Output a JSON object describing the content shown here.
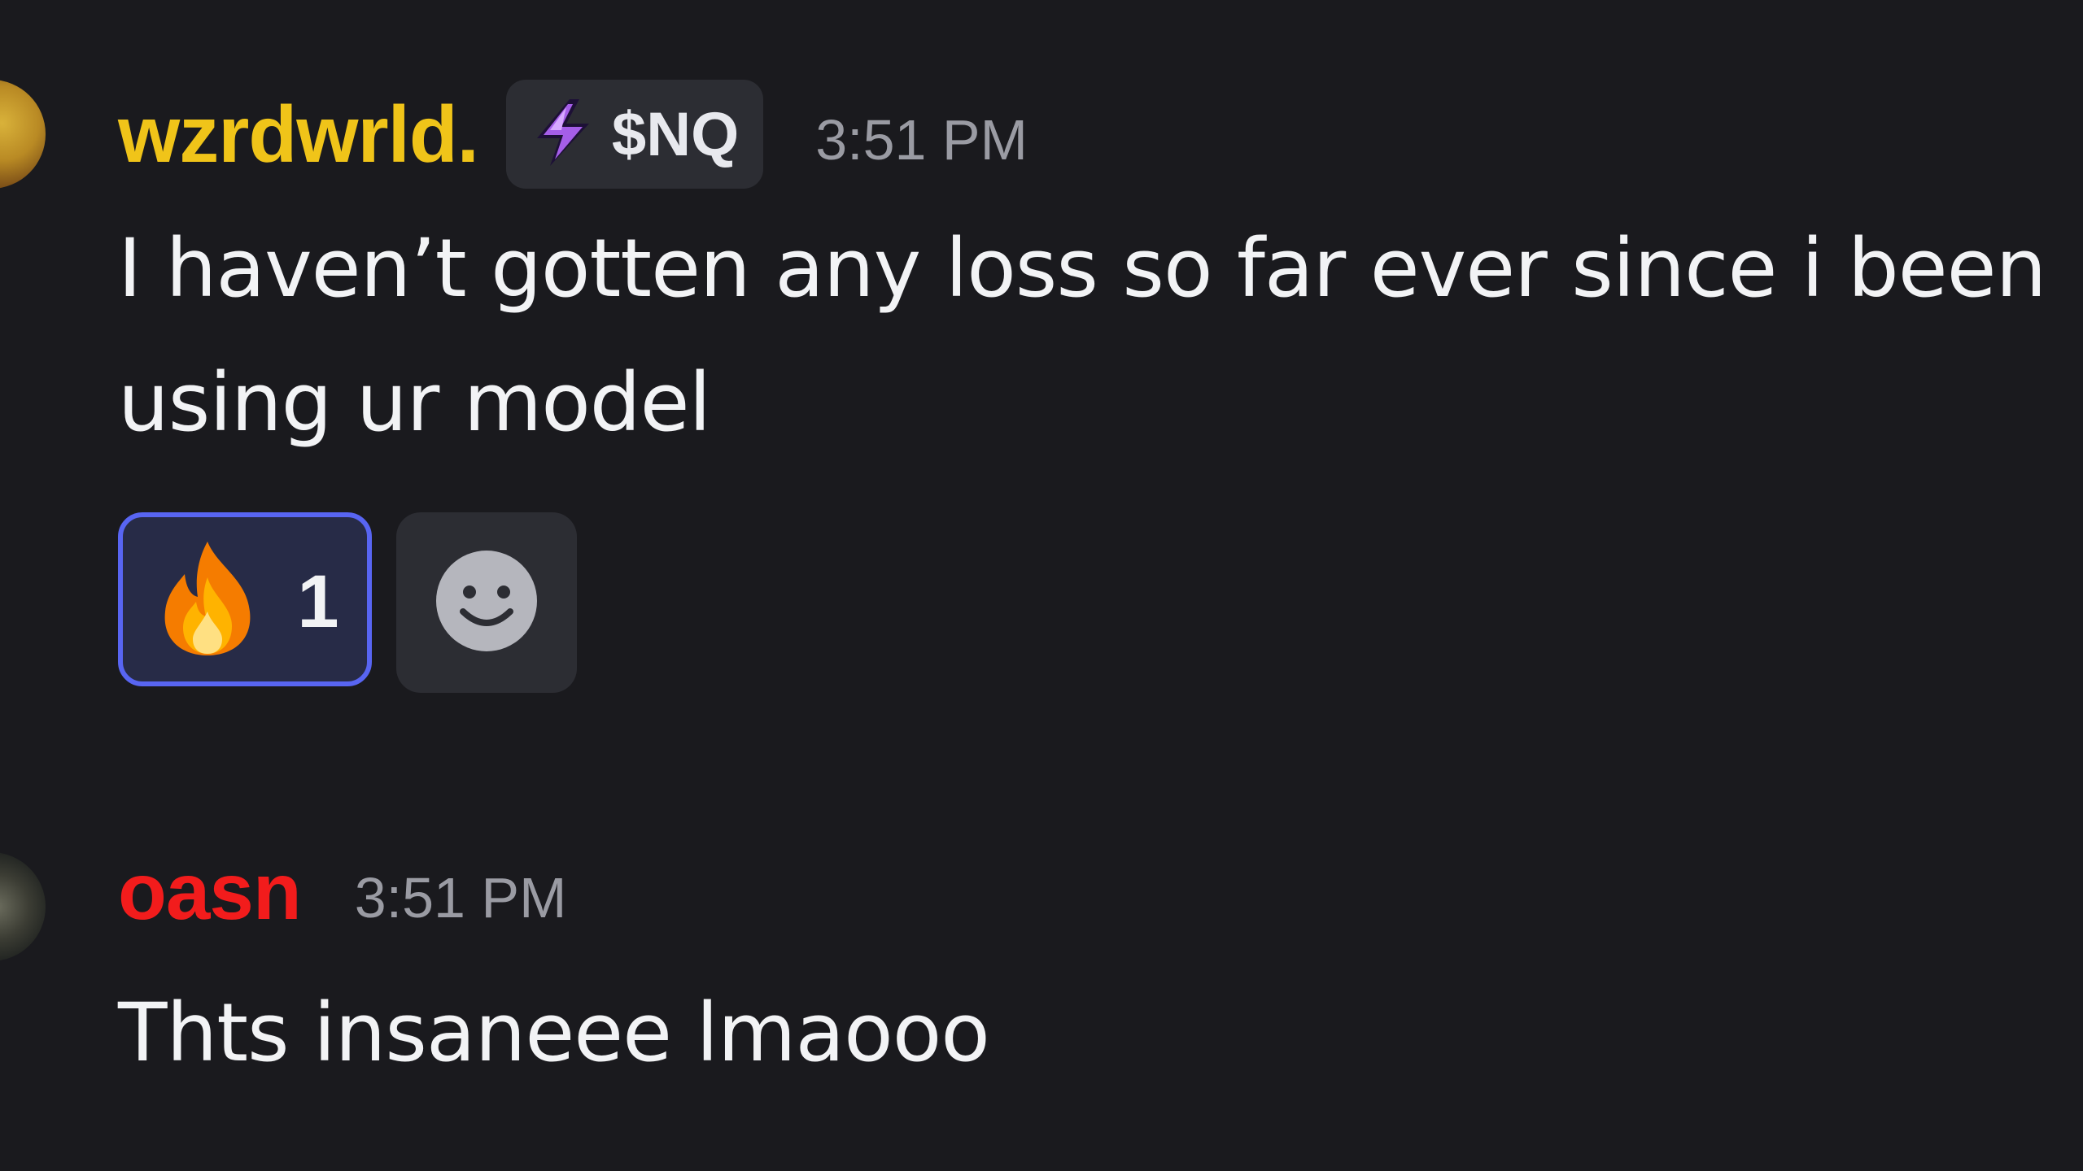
{
  "messages": [
    {
      "username": "wzrdwrld.",
      "username_color": "#f0c419",
      "tag": {
        "icon": "lightning-bolt-icon",
        "label": "$NQ"
      },
      "timestamp": "3:51 PM",
      "lines": [
        "I haven’t gotten any loss so far ever since i been",
        "using ur model"
      ],
      "reactions": [
        {
          "emoji": "fire-icon",
          "count": "1",
          "active": true
        }
      ],
      "add_reaction_icon": "smiley-icon"
    },
    {
      "username": "oasn",
      "username_color": "#f21c1c",
      "timestamp": "3:51 PM",
      "lines": [
        "Thts insaneee lmaooo"
      ]
    }
  ],
  "colors": {
    "background": "#1a1a1e",
    "timestamp": "#9a9ba3",
    "reaction_active_border": "#5865f2",
    "reaction_active_bg": "#272b47"
  }
}
